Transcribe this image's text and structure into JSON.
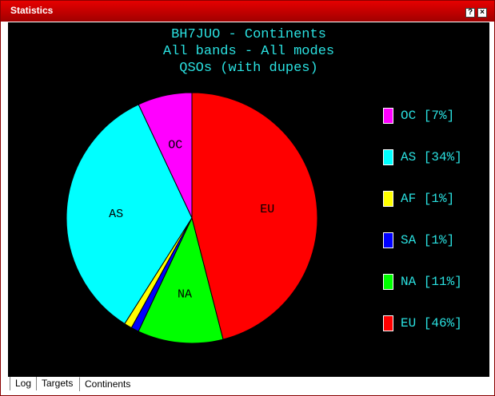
{
  "window": {
    "title": "Statistics",
    "help_glyph": "?",
    "close_glyph": "×"
  },
  "colors": {
    "titlebar": "#cc0000",
    "plot_background": "#000000",
    "text": "#2ae0e0"
  },
  "chart_data": {
    "type": "pie",
    "title_lines": [
      "BH7JUO - Continents",
      "All bands - All modes",
      "QSOs (with dupes)"
    ],
    "slices": [
      {
        "name": "OC",
        "value": 7,
        "legend": "OC [7%]",
        "color": "#ff00ff",
        "label": "OC"
      },
      {
        "name": "AS",
        "value": 34,
        "legend": "AS [34%]",
        "color": "#00ffff",
        "label": "AS"
      },
      {
        "name": "AF",
        "value": 1,
        "legend": "AF [1%]",
        "color": "#ffff00",
        "label": ""
      },
      {
        "name": "SA",
        "value": 1,
        "legend": "SA [1%]",
        "color": "#0000ff",
        "label": ""
      },
      {
        "name": "NA",
        "value": 11,
        "legend": "NA [11%]",
        "color": "#00ff00",
        "label": "NA"
      },
      {
        "name": "EU",
        "value": 46,
        "legend": "EU [46%]",
        "color": "#ff0000",
        "label": "EU"
      }
    ],
    "legend_position": "right"
  },
  "tabs": [
    {
      "label": "Log",
      "active": false
    },
    {
      "label": "Targets",
      "active": false
    },
    {
      "label": "Continents",
      "active": true
    }
  ]
}
